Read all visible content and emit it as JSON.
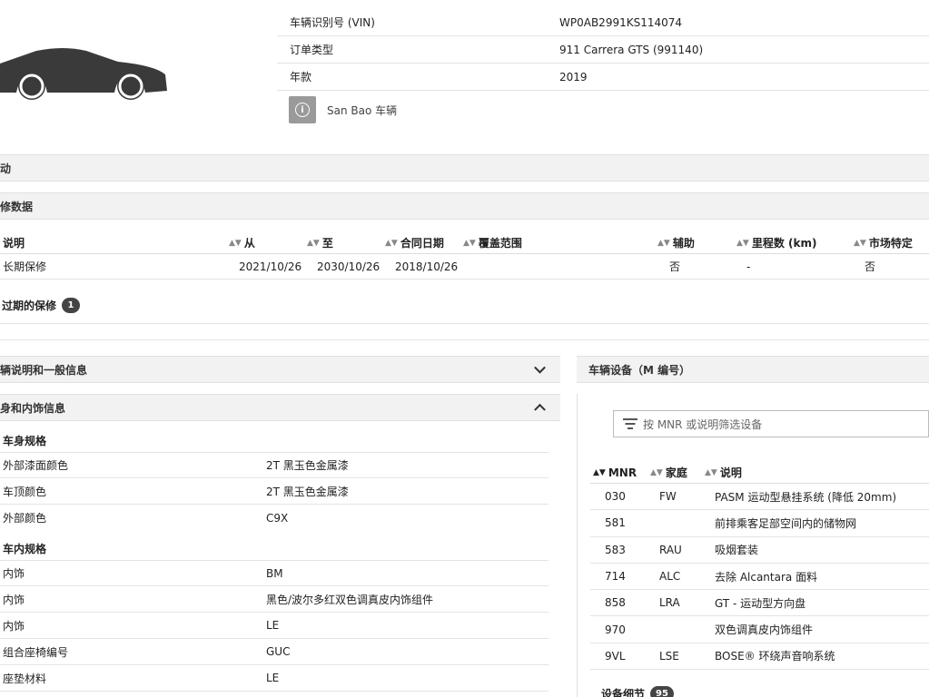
{
  "vehicle": {
    "car_icon": "car-silhouette-icon",
    "rows": [
      {
        "key": "车辆识别号 (VIN)",
        "value": "WP0AB2991KS114074"
      },
      {
        "key": "订单类型",
        "value": "911 Carrera GTS (991140)"
      },
      {
        "key": "年款",
        "value": "2019"
      }
    ],
    "sanbao_label": "San Bao 车辆",
    "info_icon": "info-icon"
  },
  "bars": {
    "activity": "活动",
    "warranty_data": "保修数据"
  },
  "warranty_table": {
    "headers": [
      "说明",
      "从",
      "至",
      "合同日期",
      "覆盖范围",
      "辅助",
      "里程数 (km)",
      "市场特定"
    ],
    "row": [
      "长期保修",
      "2021/10/26",
      "2030/10/26",
      "2018/10/26",
      "",
      "否",
      "-",
      "否"
    ]
  },
  "expired": {
    "label": "过期的保修",
    "count": "1"
  },
  "left_panel": {
    "general_title": "车辆说明和一般信息",
    "body_title": "车身和内饰信息",
    "body_spec": {
      "title": "车身规格",
      "rows": [
        {
          "key": "外部漆面颜色",
          "value": "2T 黑玉色金属漆"
        },
        {
          "key": "车顶颜色",
          "value": "2T 黑玉色金属漆"
        },
        {
          "key": "外部颜色",
          "value": "C9X"
        }
      ]
    },
    "interior_spec": {
      "title": "车内规格",
      "rows": [
        {
          "key": "内饰",
          "value": "BM"
        },
        {
          "key": "内饰",
          "value": "黑色/波尔多红双色调真皮内饰组件"
        },
        {
          "key": "内饰",
          "value": "LE"
        },
        {
          "key": "组合座椅编号",
          "value": "GUC"
        },
        {
          "key": "座垫材料",
          "value": "LE"
        }
      ]
    }
  },
  "right_panel": {
    "title": "车辆设备（M 编号）",
    "filter_placeholder": "按 MNR 或说明筛选设备",
    "headers": [
      "MNR",
      "家庭",
      "说明"
    ],
    "rows": [
      {
        "mnr": "030",
        "family": "FW",
        "desc": "PASM 运动型悬挂系统 (降低 20mm)"
      },
      {
        "mnr": "581",
        "family": "",
        "desc": "前排乘客足部空间内的储物网"
      },
      {
        "mnr": "583",
        "family": "RAU",
        "desc": "吸烟套装"
      },
      {
        "mnr": "714",
        "family": "ALC",
        "desc": "去除 Alcantara 面料"
      },
      {
        "mnr": "858",
        "family": "LRA",
        "desc": "GT - 运动型方向盘"
      },
      {
        "mnr": "970",
        "family": "",
        "desc": "双色调真皮内饰组件"
      },
      {
        "mnr": "9VL",
        "family": "LSE",
        "desc": "BOSE® 环绕声音响系统"
      }
    ],
    "details_label": "设备细节",
    "details_count": "95"
  }
}
